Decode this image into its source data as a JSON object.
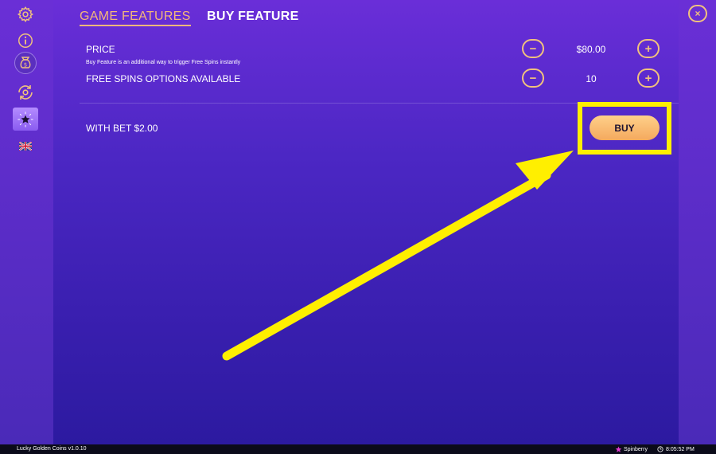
{
  "tabs": {
    "game_features": "GAME FEATURES",
    "buy_feature": "BUY FEATURE"
  },
  "price": {
    "label": "PRICE",
    "value": "$80.00",
    "description": "Buy Feature is an additional way to trigger Free Spins instantly"
  },
  "free_spins": {
    "label": "FREE SPINS OPTIONS AVAILABLE",
    "value": "10"
  },
  "bet": {
    "label": "WITH BET $2.00"
  },
  "buy_button": {
    "label": "BUY"
  },
  "footer": {
    "game": "Lucky Golden Coins v1.0.10",
    "brand": "Spinberry",
    "time": "8:05:52 PM"
  },
  "colors": {
    "accent": "#f1c27d",
    "highlight": "#ffef00",
    "tab_active": "#f4b77a"
  }
}
